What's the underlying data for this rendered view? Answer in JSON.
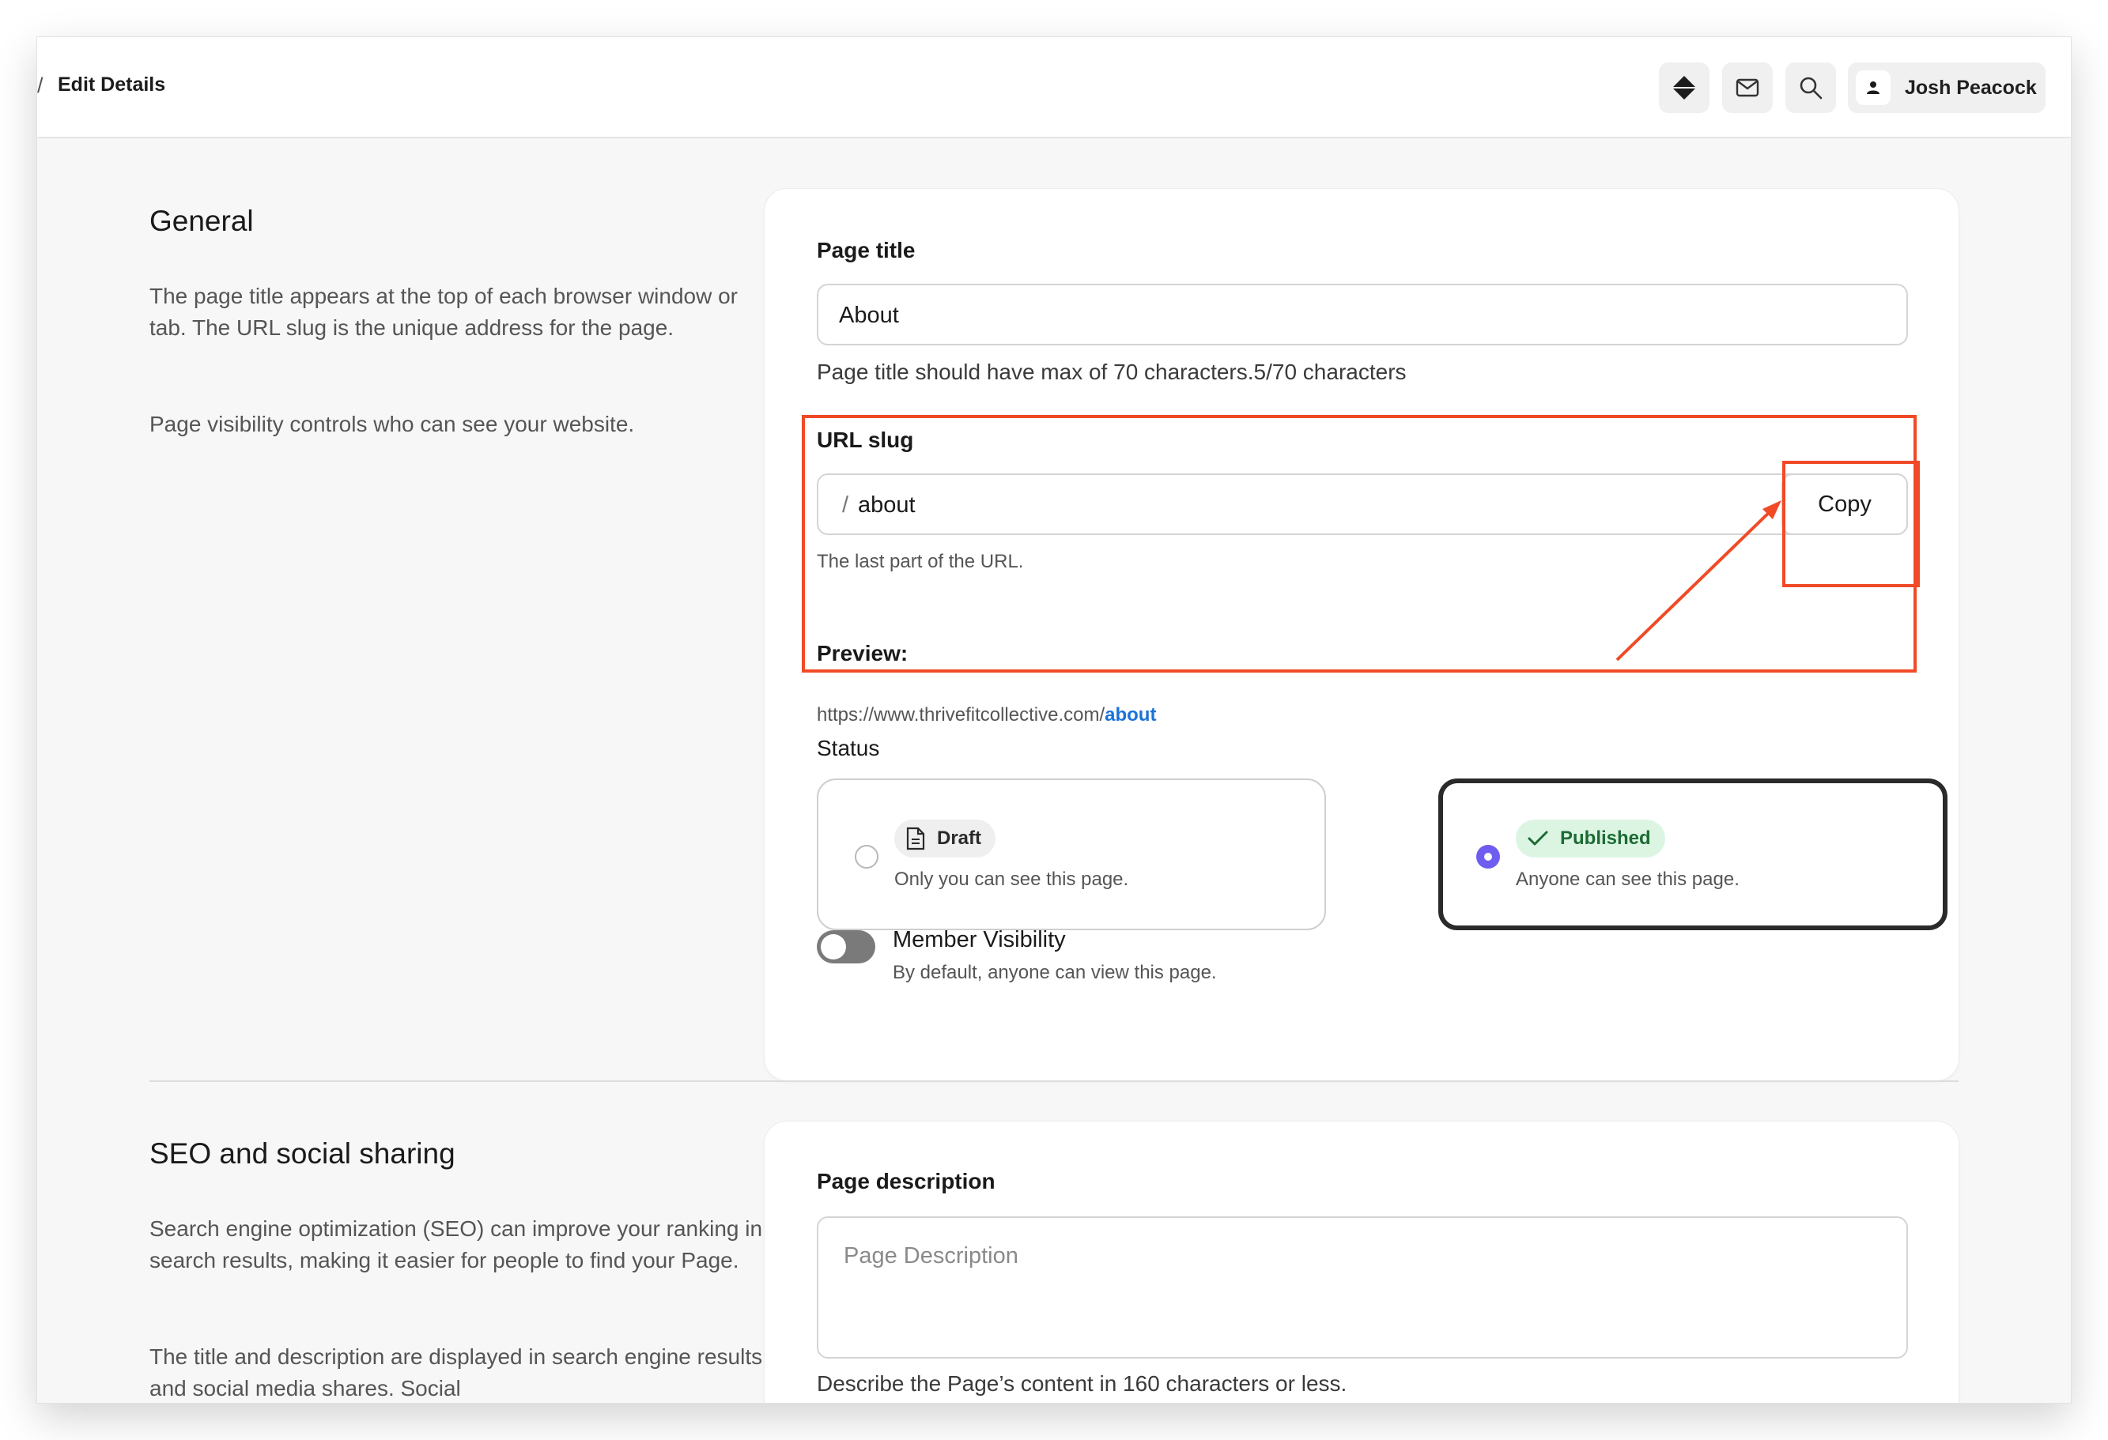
{
  "topbar": {
    "breadcrumb_separator": "/",
    "breadcrumb_current": "Edit Details",
    "user_name": "Josh Peacock"
  },
  "general": {
    "title": "General",
    "desc1": "The page title appears at the top of each browser window or tab. The URL slug is the unique address for the page.",
    "desc2": "Page visibility controls who can see your website."
  },
  "page_title": {
    "label": "Page title",
    "value": "About",
    "helper": "Page title should have max of 70 characters.5/70 characters"
  },
  "url_slug": {
    "label": "URL slug",
    "prefix": "/",
    "value": "about",
    "copy_label": "Copy",
    "helper": "The last part of the URL.",
    "preview_label": "Preview:",
    "preview_base": "https://www.thrivefitcollective.com/",
    "preview_slug": "about"
  },
  "status": {
    "label": "Status",
    "options": [
      {
        "label": "Draft",
        "desc": "Only you can see this page.",
        "selected": false
      },
      {
        "label": "Published",
        "desc": "Anyone can see this page.",
        "selected": true
      }
    ]
  },
  "member_visibility": {
    "label": "Member Visibility",
    "desc": "By default, anyone can view this page.",
    "enabled": false
  },
  "seo": {
    "title": "SEO and social sharing",
    "desc1": "Search engine optimization (SEO) can improve your ranking in search results, making it easier for people to find your Page.",
    "desc2": "The title and description are displayed in search engine results and social media shares. Social",
    "description_label": "Page description",
    "description_placeholder": "Page Description",
    "description_helper": "Describe the Page’s content in 160 characters or less."
  },
  "colors": {
    "accent": "#6f5cf0",
    "annotation": "#f04a26",
    "link": "#1a73d9",
    "published_bg": "#dcf5e3",
    "published_text": "#1d6b34"
  },
  "icons": [
    "diamond-icon",
    "mail-icon",
    "search-icon",
    "user-icon",
    "document-icon",
    "check-icon"
  ]
}
